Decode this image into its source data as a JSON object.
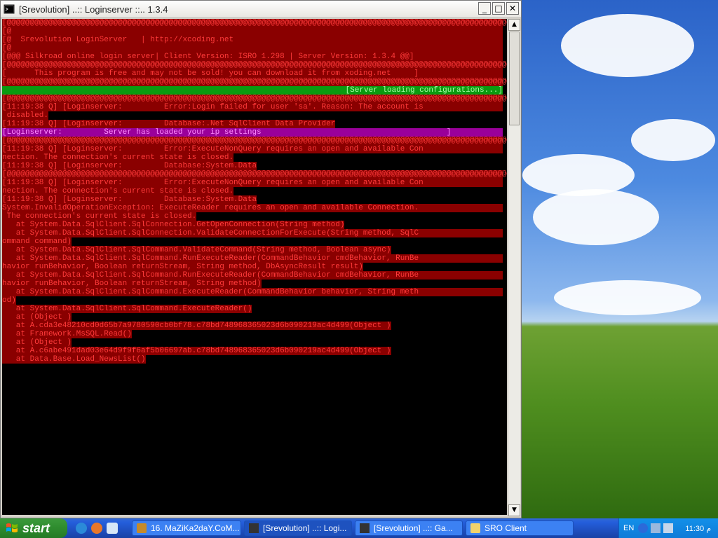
{
  "window": {
    "title": "[Srevolution] ..:: Loginserver ::.. 1.3.4",
    "minimize": "_",
    "maximize": "□",
    "close": "✕"
  },
  "console": {
    "lines": [
      {
        "style": "full",
        "text": "[@@@@@@@@@@@@@@@@@@@@@@@@@@@@@@@@@@@@@@@@@@@@@@@@@@@@@@@@@@@@@@@@@@@@@@@@@@@@@@@@@@@@@@@@@@@@@@@@@@@@@@@@@@@@@@@@@@@@@@@@@@]"
      },
      {
        "style": "full",
        "text": "[@                                                                                                                    @]"
      },
      {
        "style": "full",
        "text": "[@  Srevolution LoginServer   | http://xcoding.net                                                                   @]"
      },
      {
        "style": "full",
        "text": "[@                                                                                                                    @]"
      },
      {
        "style": "full",
        "text": "[@@@ Silkroad online login server| Client Version: ISRO 1.298 | Server Version: 1.3.4 @@]"
      },
      {
        "style": "full",
        "text": "[@@@@@@@@@@@@@@@@@@@@@@@@@@@@@@@@@@@@@@@@@@@@@@@@@@@@@@@@@@@@@@@@@@@@@@@@@@@@@@@@@@@@@@@@@@@@@@@@@@@@@@@@@@@@@@@@@@@@@@@@@@]"
      },
      {
        "style": "full",
        "text": "[      This program is free and may not be sold! you can download it from xoding.net     ]"
      },
      {
        "style": "full",
        "text": "[@@@@@@@@@@@@@@@@@@@@@@@@@@@@@@@@@@@@@@@@@@@@@@@@@@@@@@@@@@@@@@@@@@@@@@@@@@@@@@@@@@@@@@@@@@@@@@@@@@@@@@@@@@@@@@@@@@@@@@@@@@]"
      },
      {
        "style": "green",
        "text": "[Server loading configurations...]"
      },
      {
        "style": "full",
        "text": "[@@@@@@@@@@@@@@@@@@@@@@@@@@@@@@@@@@@@@@@@@@@@@@@@@@@@@@@@@@@@@@@@@@@@@@@@@@@@@@@@@@@@@@@@@@@@@@@@@@@@@@@@@@@@@@@@@@@@@@@@@@]"
      },
      {
        "style": "full",
        "text": "[11:19:38 Q] [Loginserver:         Error:Login failed for user 'sa'. Reason: The account is"
      },
      {
        "style": "part",
        "text": " disabled."
      },
      {
        "style": "part",
        "text": "[11:19:38 Q] [Loginserver:         Database:.Net SqlClient Data Provider"
      },
      {
        "style": "magenta",
        "text": "[Loginserver:         Server has loaded your ip settings                                        ]"
      },
      {
        "style": "full",
        "text": "[@@@@@@@@@@@@@@@@@@@@@@@@@@@@@@@@@@@@@@@@@@@@@@@@@@@@@@@@@@@@@@@@@@@@@@@@@@@@@@@@@@@@@@@@@@@@@@@@@@@@@@@@@@@@@@@@@@@@@@@@@@]"
      },
      {
        "style": "full",
        "text": "[11:19:38 Q] [Loginserver:         Error:ExecuteNonQuery requires an open and available Con"
      },
      {
        "style": "part",
        "text": "nection. The connection's current state is closed."
      },
      {
        "style": "part",
        "text": "[11:19:38 Q] [Loginserver:         Database:System.Data"
      },
      {
        "style": "full",
        "text": "[@@@@@@@@@@@@@@@@@@@@@@@@@@@@@@@@@@@@@@@@@@@@@@@@@@@@@@@@@@@@@@@@@@@@@@@@@@@@@@@@@@@@@@@@@@@@@@@@@@@@@@@@@@@@@@@@@@@@@@@@@@]"
      },
      {
        "style": "full",
        "text": "[11:19:38 Q] [Loginserver:         Error:ExecuteNonQuery requires an open and available Con"
      },
      {
        "style": "part",
        "text": "nection. The connection's current state is closed."
      },
      {
        "style": "part",
        "text": "[11:19:38 Q] [Loginserver:         Database:System.Data"
      },
      {
        "style": "full",
        "text": "System.InvalidOperationException: ExecuteReader requires an open and available Connection."
      },
      {
        "style": "part",
        "text": " The connection's current state is closed."
      },
      {
        "style": "part",
        "text": "   at System.Data.SqlClient.SqlConnection.GetOpenConnection(String method)"
      },
      {
        "style": "full",
        "text": "   at System.Data.SqlClient.SqlConnection.ValidateConnectionForExecute(String method, SqlC"
      },
      {
        "style": "part",
        "text": "ommand command)"
      },
      {
        "style": "part",
        "text": "   at System.Data.SqlClient.SqlCommand.ValidateCommand(String method, Boolean async)"
      },
      {
        "style": "full",
        "text": "   at System.Data.SqlClient.SqlCommand.RunExecuteReader(CommandBehavior cmdBehavior, RunBe"
      },
      {
        "style": "part",
        "text": "havior runBehavior, Boolean returnStream, String method, DbAsyncResult result)"
      },
      {
        "style": "full",
        "text": "   at System.Data.SqlClient.SqlCommand.RunExecuteReader(CommandBehavior cmdBehavior, RunBe"
      },
      {
        "style": "part",
        "text": "havior runBehavior, Boolean returnStream, String method)"
      },
      {
        "style": "full",
        "text": "   at System.Data.SqlClient.SqlCommand.ExecuteReader(CommandBehavior behavior, String meth"
      },
      {
        "style": "part",
        "text": "od)"
      },
      {
        "style": "part",
        "text": "   at System.Data.SqlClient.SqlCommand.ExecuteReader()"
      },
      {
        "style": "part",
        "text": "   at (Object )"
      },
      {
        "style": "part",
        "text": "   at A.cda3e48210cd0d65b7a9780590cb0bf78.c78bd748968365023d6b090219ac4d499(Object )"
      },
      {
        "style": "part",
        "text": "   at Framework.MsSQL.Read()"
      },
      {
        "style": "part",
        "text": "   at (Object )"
      },
      {
        "style": "part",
        "text": "   at A.c6abe491dad03e64d9f9f6af5b06697ab.c78bd748968365023d6b090219ac4d499(Object )"
      },
      {
        "style": "part",
        "text": "   at Data.Base.Load_NewsList()"
      }
    ]
  },
  "taskbar": {
    "start_label": "start",
    "tasks": [
      {
        "label": "16. MaZiKa2daY.CoM...",
        "icon": "winamp-icon"
      },
      {
        "label": "[Srevolution] ..:: Logi...",
        "icon": "console-icon"
      },
      {
        "label": "[Srevolution] ..:: Ga...",
        "icon": "console-icon"
      },
      {
        "label": "SRO Client",
        "icon": "folder-icon"
      }
    ],
    "tray": {
      "lang": "EN",
      "clock": "11:30 ‫م‬"
    }
  },
  "colors": {
    "error_bg": "#8a0000",
    "error_text": "#ff3a3a",
    "ok_bg": "#0a9b10",
    "info_bg": "#9a009a"
  }
}
